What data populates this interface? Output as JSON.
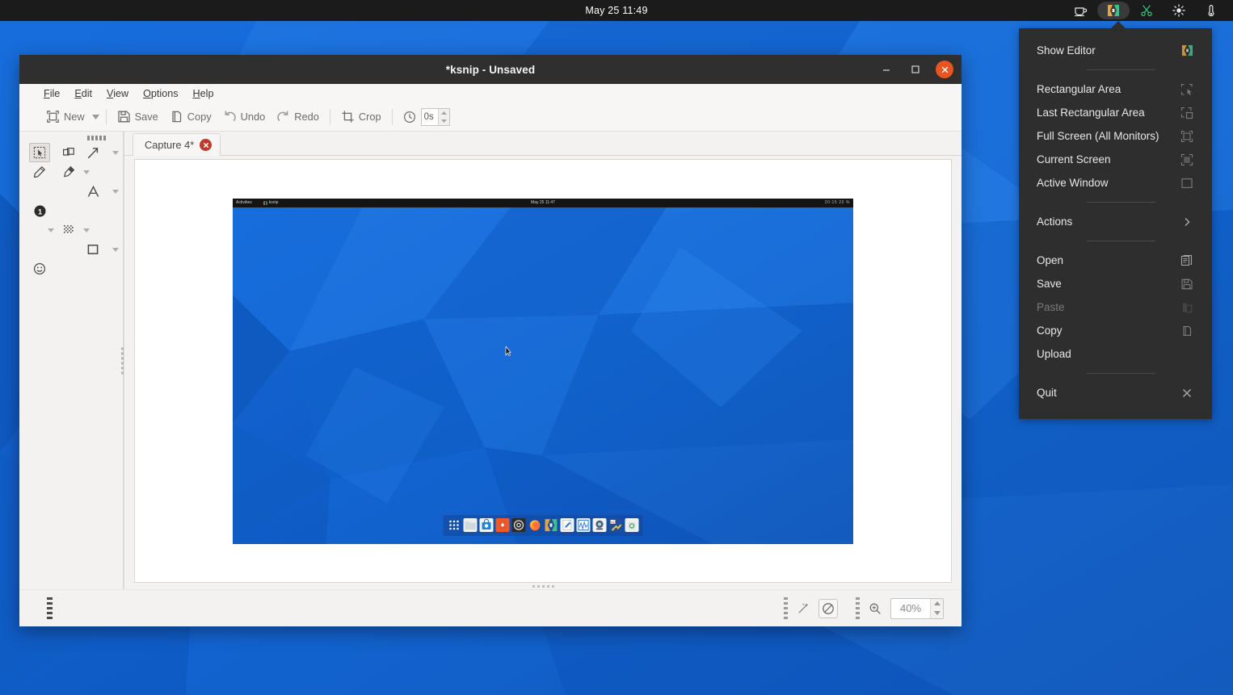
{
  "panel": {
    "clock": "May 25  11:49",
    "tray": [
      {
        "name": "coffee-cup-icon",
        "label": "Caffeine",
        "active": false
      },
      {
        "name": "ksnip-tray-icon",
        "label": "ksnip",
        "active": true
      },
      {
        "name": "scissors-icon",
        "label": "Screenshot tool",
        "active": false
      },
      {
        "name": "brightness-icon",
        "label": "Brightness",
        "active": false
      },
      {
        "name": "thermometer-icon",
        "label": "Temperature",
        "active": false
      }
    ]
  },
  "tray_menu": {
    "items": [
      {
        "label": "Show Editor",
        "icon": "ksnip-logo-icon",
        "disabled": false,
        "separator_after": true
      },
      {
        "label": "Rectangular Area",
        "icon": "rectangular-area-icon",
        "disabled": false
      },
      {
        "label": "Last Rectangular Area",
        "icon": "last-rectangular-area-icon",
        "disabled": false
      },
      {
        "label": "Full Screen (All Monitors)",
        "icon": "full-screen-icon",
        "disabled": false
      },
      {
        "label": "Current Screen",
        "icon": "current-screen-icon",
        "disabled": false
      },
      {
        "label": "Active Window",
        "icon": "active-window-icon",
        "disabled": false,
        "separator_after": true
      },
      {
        "label": "Actions",
        "icon": "chevron-right-icon",
        "disabled": false,
        "separator_after": true
      },
      {
        "label": "Open",
        "icon": "open-folder-icon",
        "disabled": false
      },
      {
        "label": "Save",
        "icon": "save-floppy-icon",
        "disabled": false
      },
      {
        "label": "Paste",
        "icon": "paste-icon",
        "disabled": true
      },
      {
        "label": "Copy",
        "icon": "copy-icon",
        "disabled": false
      },
      {
        "label": "Upload",
        "icon": "",
        "disabled": false,
        "separator_after": true
      },
      {
        "label": "Quit",
        "icon": "close-x-icon",
        "disabled": false
      }
    ]
  },
  "window": {
    "title": "*ksnip - Unsaved",
    "buttons": {
      "minimize": "minimize-icon",
      "maximize": "maximize-icon",
      "close": "close-icon"
    }
  },
  "menubar": [
    {
      "label": "File",
      "mnemonic": "F"
    },
    {
      "label": "Edit",
      "mnemonic": "E"
    },
    {
      "label": "View",
      "mnemonic": "V"
    },
    {
      "label": "Options",
      "mnemonic": "O"
    },
    {
      "label": "Help",
      "mnemonic": "H"
    }
  ],
  "toolbar": {
    "new_label": "New",
    "save_label": "Save",
    "copy_label": "Copy",
    "undo_label": "Undo",
    "redo_label": "Redo",
    "crop_label": "Crop",
    "delay_value": "0s"
  },
  "tooldock": {
    "tools": [
      {
        "name": "select-tool",
        "selected": true,
        "has_dropdown": false
      },
      {
        "name": "duplicate-tool",
        "selected": false,
        "has_dropdown": false
      },
      {
        "name": "arrow-tool",
        "selected": false,
        "has_dropdown": true
      },
      {
        "name": "pen-tool",
        "selected": false,
        "has_dropdown": false
      },
      {
        "name": "marker-tool",
        "selected": false,
        "has_dropdown": true
      },
      {
        "name": "text-tool",
        "selected": false,
        "has_dropdown": true
      },
      {
        "name": "number-tool",
        "selected": false,
        "has_dropdown": true
      },
      {
        "name": "blur-tool",
        "selected": false,
        "has_dropdown": true
      },
      {
        "name": "rectangle-tool",
        "selected": false,
        "has_dropdown": true
      },
      {
        "name": "sticker-tool",
        "selected": false,
        "has_dropdown": false
      }
    ]
  },
  "tabs": [
    {
      "label": "Capture 4*",
      "active": true,
      "closable": true
    }
  ],
  "statusbar": {
    "zoom_value": "40%",
    "effect_label": "no-effect"
  },
  "captured_image": {
    "topbar_left_items": [
      "Activities",
      "ksnip"
    ],
    "topbar_clock": "May 25  11:47",
    "topbar_right_text": "20:15   20 %",
    "dock_icons": [
      "app-grid-icon",
      "files-icon",
      "software-center-icon",
      "brave-icon",
      "settings-icon",
      "firefox-icon",
      "ksnip-icon",
      "text-editor-icon",
      "system-monitor-icon",
      "webcam-icon",
      "x11-tool-icon",
      "trash-icon"
    ]
  },
  "colors": {
    "accent_close": "#e95420",
    "tab_close": "#c0392b",
    "titlebar": "#2f2f2f",
    "menu_bg": "#2e2e2e",
    "desktop_blue": "#0e5ec9",
    "window_bg": "#f4f2f1"
  }
}
